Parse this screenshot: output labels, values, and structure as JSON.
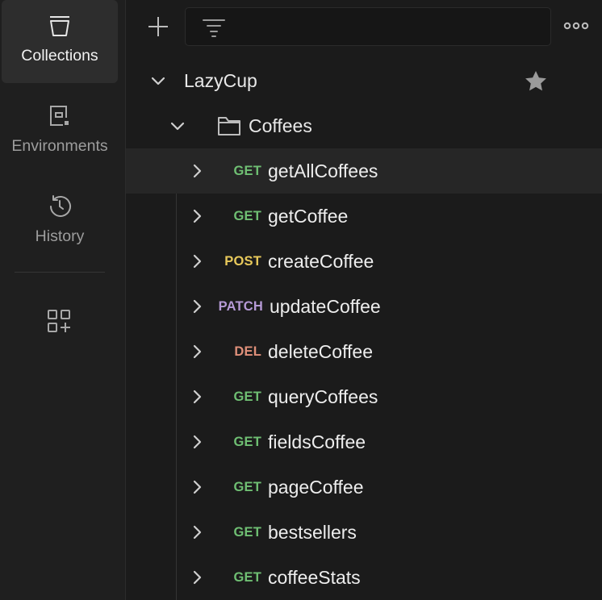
{
  "colors": {
    "get": "#6fbf73",
    "post": "#e8c95b",
    "patch": "#b69ad6",
    "del": "#e0907a"
  },
  "sidebar": {
    "items": [
      {
        "label": "Collections",
        "icon": "collections-icon",
        "active": true
      },
      {
        "label": "Environments",
        "icon": "environments-icon",
        "active": false
      },
      {
        "label": "History",
        "icon": "history-icon",
        "active": false
      }
    ],
    "extra_icon": "apps-add-icon"
  },
  "toolbar": {
    "new_icon": "plus-icon",
    "filter_icon": "filter-icon",
    "filter_placeholder": "",
    "more_icon": "more-horizontal-icon"
  },
  "collection": {
    "name": "LazyCup",
    "starred": true,
    "folder": {
      "name": "Coffees",
      "requests": [
        {
          "method": "GET",
          "name": "getAllCoffees",
          "selected": true
        },
        {
          "method": "GET",
          "name": "getCoffee"
        },
        {
          "method": "POST",
          "name": "createCoffee"
        },
        {
          "method": "PATCH",
          "name": "updateCoffee"
        },
        {
          "method": "DEL",
          "name": "deleteCoffee"
        },
        {
          "method": "GET",
          "name": "queryCoffees"
        },
        {
          "method": "GET",
          "name": "fieldsCoffee"
        },
        {
          "method": "GET",
          "name": "pageCoffee"
        },
        {
          "method": "GET",
          "name": "bestsellers"
        },
        {
          "method": "GET",
          "name": "coffeeStats"
        }
      ]
    }
  }
}
